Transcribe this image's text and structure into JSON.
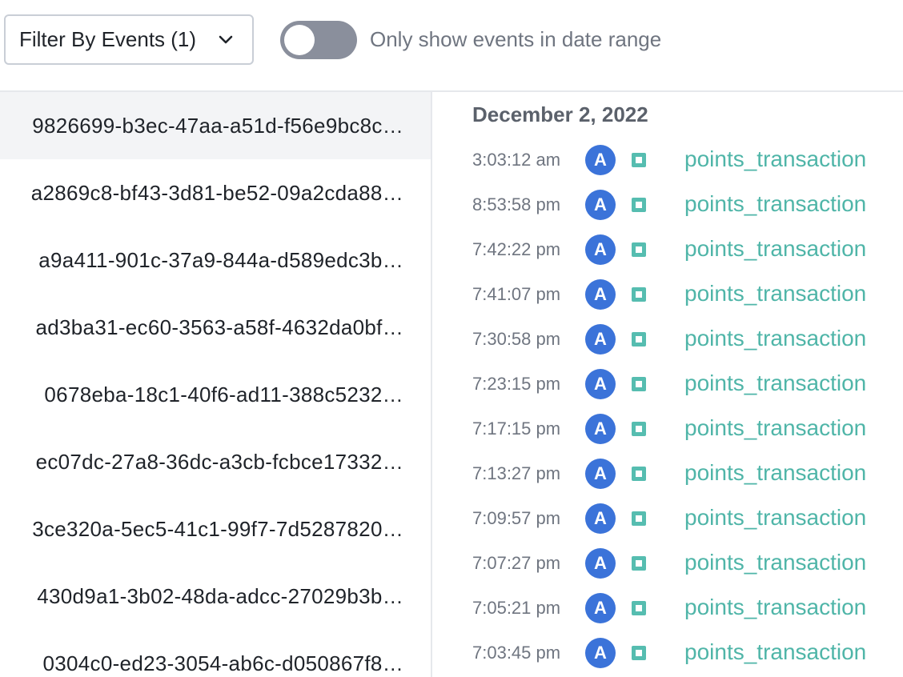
{
  "toolbar": {
    "filter_label": "Filter By Events (1)",
    "toggle_label": "Only show events in date range",
    "toggle_on": false
  },
  "users": [
    "9826699-b3ec-47aa-a51d-f56e9bc8c…",
    "a2869c8-bf43-3d81-be52-09a2cda88…",
    "a9a411-901c-37a9-844a-d589edc3b…",
    "ad3ba31-ec60-3563-a58f-4632da0bf…",
    "0678eba-18c1-40f6-ad11-388c5232…",
    "ec07dc-27a8-36dc-a3cb-fcbce17332…",
    "3ce320a-5ec5-41c1-99f7-7d5287820…",
    "430d9a1-3b02-48da-adcc-27029b3b…",
    "0304c0-ed23-3054-ab6c-d050867f8…"
  ],
  "selected_user_index": 0,
  "events": {
    "date": "December 2, 2022",
    "avatar_letter": "A",
    "items": [
      {
        "time": "3:03:12 am",
        "name": "points_transaction"
      },
      {
        "time": "8:53:58 pm",
        "name": "points_transaction"
      },
      {
        "time": "7:42:22 pm",
        "name": "points_transaction"
      },
      {
        "time": "7:41:07 pm",
        "name": "points_transaction"
      },
      {
        "time": "7:30:58 pm",
        "name": "points_transaction"
      },
      {
        "time": "7:23:15 pm",
        "name": "points_transaction"
      },
      {
        "time": "7:17:15 pm",
        "name": "points_transaction"
      },
      {
        "time": "7:13:27 pm",
        "name": "points_transaction"
      },
      {
        "time": "7:09:57 pm",
        "name": "points_transaction"
      },
      {
        "time": "7:07:27 pm",
        "name": "points_transaction"
      },
      {
        "time": "7:05:21 pm",
        "name": "points_transaction"
      },
      {
        "time": "7:03:45 pm",
        "name": "points_transaction"
      }
    ]
  },
  "colors": {
    "avatar": "#3b73d9",
    "event_icon": "#56bdb0",
    "event_name": "#4fb5a8",
    "toggle_off": "#8a8f9c"
  }
}
